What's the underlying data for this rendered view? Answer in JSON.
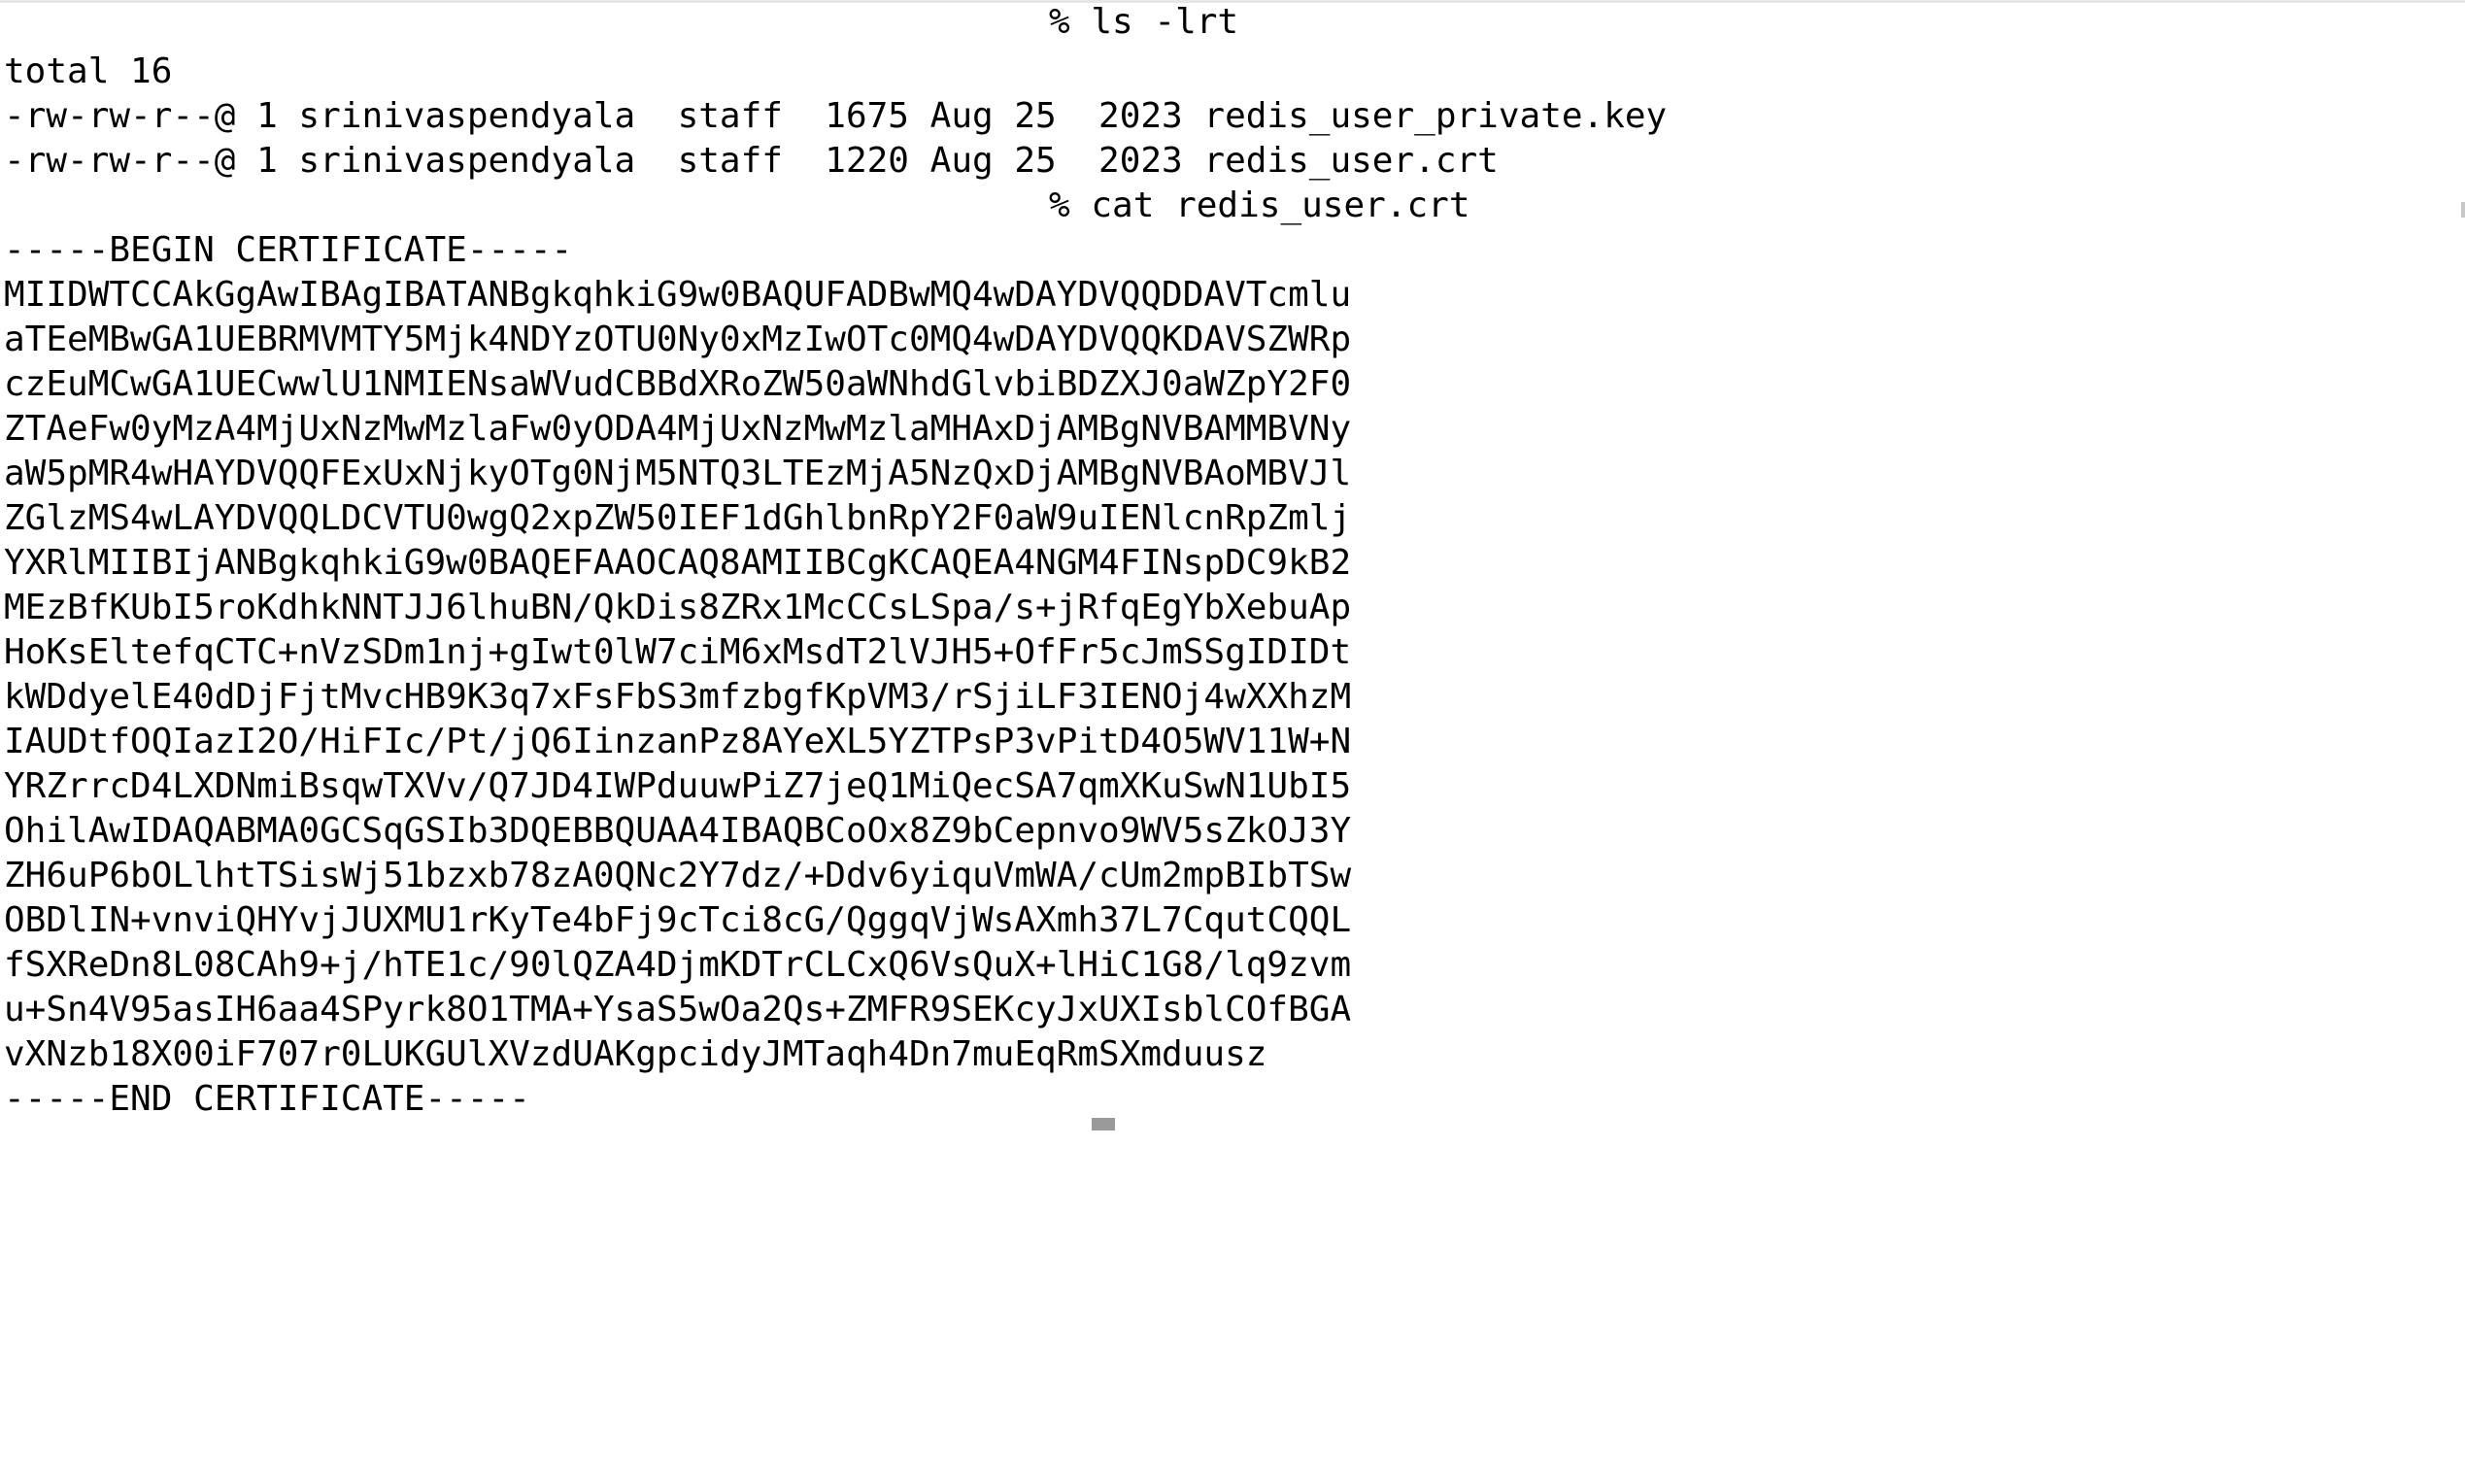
{
  "terminal": {
    "prompt_symbol": "%",
    "commands": {
      "ls": "ls -lrt",
      "cat": "cat redis_user.crt"
    },
    "output": {
      "total": "total 16",
      "files": [
        "-rw-rw-r--@ 1 srinivaspendyala  staff  1675 Aug 25  2023 redis_user_private.key",
        "-rw-rw-r--@ 1 srinivaspendyala  staff  1220 Aug 25  2023 redis_user.crt"
      ],
      "cert_begin": "-----BEGIN CERTIFICATE-----",
      "cert_lines": [
        "MIIDWTCCAkGgAwIBAgIBATANBgkqhkiG9w0BAQUFADBwMQ4wDAYDVQQDDAVTcmlu",
        "aTEeMBwGA1UEBRMVMTY5Mjk4NDYzOTU0Ny0xMzIwOTc0MQ4wDAYDVQQKDAVSZWRp",
        "czEuMCwGA1UECwwlU1NMIENsaWVudCBBdXRoZW50aWNhdGlvbiBDZXJ0aWZpY2F0",
        "ZTAeFw0yMzA4MjUxNzMwMzlaFw0yODA4MjUxNzMwMzlaMHAxDjAMBgNVBAMMBVNy",
        "aW5pMR4wHAYDVQQFExUxNjkyOTg0NjM5NTQ3LTEzMjA5NzQxDjAMBgNVBAoMBVJl",
        "ZGlzMS4wLAYDVQQLDCVTU0wgQ2xpZW50IEF1dGhlbnRpY2F0aW9uIENlcnRpZmlj",
        "YXRlMIIBIjANBgkqhkiG9w0BAQEFAAOCAQ8AMIIBCgKCAQEA4NGM4FINspDC9kB2",
        "MEzBfKUbI5roKdhkNNTJJ6lhuBN/QkDis8ZRx1McCCsLSpa/s+jRfqEgYbXebuAp",
        "HoKsEltefqCTC+nVzSDm1nj+gIwt0lW7ciM6xMsdT2lVJH5+OfFr5cJmSSgIDIDt",
        "kWDdyelE40dDjFjtMvcHB9K3q7xFsFbS3mfzbgfKpVM3/rSjiLF3IENOj4wXXhzM",
        "IAUDtfOQIazI2O/HiFIc/Pt/jQ6IinzanPz8AYeXL5YZTPsP3vPitD4O5WV11W+N",
        "YRZrrcD4LXDNmiBsqwTXVv/Q7JD4IWPduuwPiZ7jeQ1MiQecSA7qmXKuSwN1UbI5",
        "OhilAwIDAQABMA0GCSqGSIb3DQEBBQUAA4IBAQBCoOx8Z9bCepnvo9WV5sZkOJ3Y",
        "ZH6uP6bOLlhtTSisWj51bzxb78zA0QNc2Y7dz/+Ddv6yiquVmWA/cUm2mpBIbTSw",
        "OBDlIN+vnviQHYvjJUXMU1rKyTe4bFj9cTci8cG/QggqVjWsAXmh37L7CqutCQQL",
        "fSXReDn8L08CAh9+j/hTE1c/90lQZA4DjmKDTrCLCxQ6VsQuX+lHiC1G8/lq9zvm",
        "u+Sn4V95asIH6aa4SPyrk8O1TMA+YsaS5wOa2Qs+ZMFR9SEKcyJxUXIsblCOfBGA",
        "vXNzb18X00iF707r0LUKGUlXVzdUAKgpcidyJMTaqh4Dn7muEqRmSXmduusz"
      ],
      "cert_end": "-----END CERTIFICATE-----"
    }
  }
}
